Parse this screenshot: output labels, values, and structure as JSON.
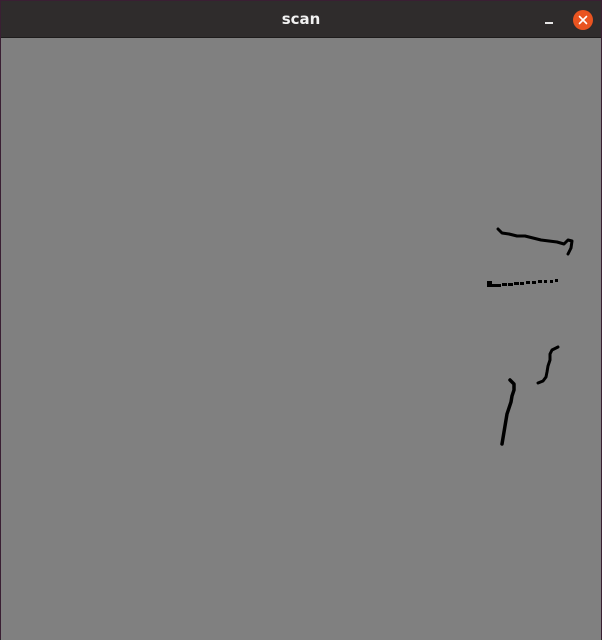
{
  "window": {
    "title": "scan",
    "minimize_icon": "minimize-icon",
    "close_icon": "close-icon",
    "close_color": "#e95420"
  },
  "canvas": {
    "background": "#808080",
    "point_color": "#000000"
  }
}
